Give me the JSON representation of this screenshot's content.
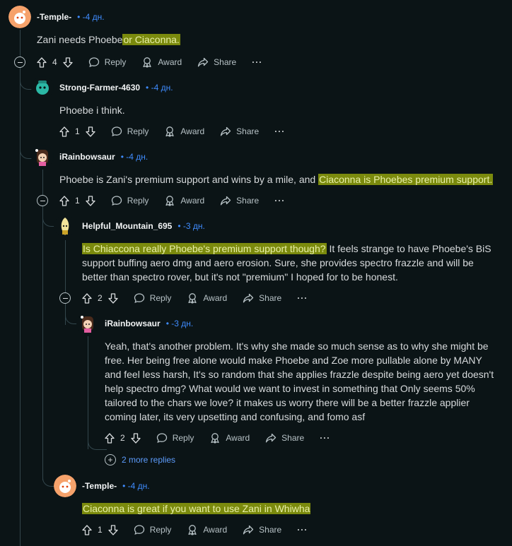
{
  "actions": {
    "reply": "Reply",
    "award": "Award",
    "share": "Share",
    "more": "···"
  },
  "comments": [
    {
      "author": "-Temple-",
      "time": "• -4 дн.",
      "body_plain": "Zani needs Phoebe",
      "body_hl": "or Ciaconna.",
      "votes": "4"
    },
    {
      "author": "Strong-Farmer-4630",
      "time": "• -4 дн.",
      "body_plain": "Phoebe i think.",
      "votes": "1"
    },
    {
      "author": "iRainbowsaur",
      "time": "• -4 дн.",
      "body_plain": "Phoebe is Zani's premium support and wins by a mile, and",
      "body_hl": "Ciaconna is Phoebes premium support.",
      "votes": "1"
    },
    {
      "author": "Helpful_Mountain_695",
      "time": "• -3 дн.",
      "body_hl": "Is Chiaccona really Phoebe's premium support though?",
      "body_line1_rest": "It feels strange to have Phoebe's BiS",
      "body_line2": "support buffing aero dmg and aero erosion. Sure, she provides spectro frazzle and will be",
      "body_line3": "better than spectro rover, but it's not \"premium\" I hoped for to be honest.",
      "votes": "2"
    },
    {
      "author": "iRainbowsaur",
      "time": "• -3 дн.",
      "lines": [
        "Yeah, that's another problem. It's why she made so much sense as to why she might be",
        "free. Her being free alone would make Phoebe and Zoe more pullable alone by MANY",
        "and feel less harsh, It's so random that she applies frazzle despite being aero yet doesn't",
        "help spectro dmg? What would we want to invest in something that Only seems 50%",
        "tailored to the chars we love? it makes us worry there will be a better frazzle applier",
        "coming later, its very upsetting and confusing, and fomo asf"
      ],
      "votes": "2"
    },
    {
      "author": "-Temple-",
      "time": "• -4 дн.",
      "body_hl": "Ciaconna is great if you want to use Zani in Whiwha",
      "votes": "1"
    }
  ],
  "more_replies": "2 more replies"
}
